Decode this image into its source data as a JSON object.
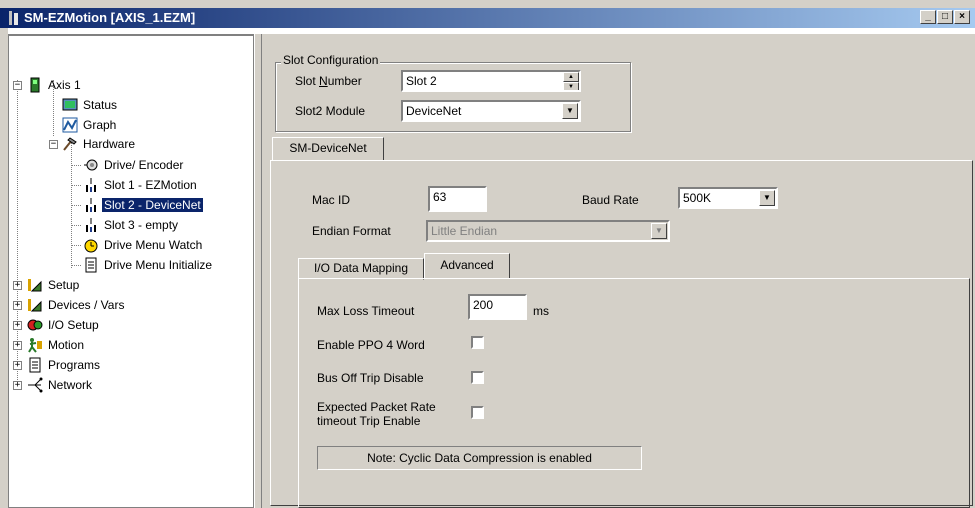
{
  "window": {
    "title": "SM-EZMotion   [AXIS_1.EZM]",
    "min_glyph": "_",
    "max_glyph": "□",
    "close_glyph": "×"
  },
  "tree": {
    "root": {
      "label": "Axis 1",
      "expander": "−"
    },
    "items": [
      {
        "label": "Status",
        "icon": "status-icon"
      },
      {
        "label": "Graph",
        "icon": "graph-icon"
      },
      {
        "label": "Hardware",
        "icon": "hardware-icon",
        "expander": "−"
      },
      {
        "label": "Drive/ Encoder",
        "icon": "encoder-icon"
      },
      {
        "label": "Slot 1 - EZMotion",
        "icon": "slot-icon"
      },
      {
        "label": "Slot 2 - DeviceNet",
        "icon": "slot-icon",
        "selected": true
      },
      {
        "label": "Slot 3 - empty",
        "icon": "slot-icon"
      },
      {
        "label": "Drive Menu Watch",
        "icon": "watch-icon"
      },
      {
        "label": "Drive Menu Initialize",
        "icon": "initialize-icon"
      },
      {
        "label": "Setup",
        "icon": "setup-icon",
        "expander": "+"
      },
      {
        "label": "Devices / Vars",
        "icon": "devices-icon",
        "expander": "+"
      },
      {
        "label": "I/O Setup",
        "icon": "io-icon",
        "expander": "+"
      },
      {
        "label": "Motion",
        "icon": "motion-icon",
        "expander": "+"
      },
      {
        "label": "Programs",
        "icon": "programs-icon",
        "expander": "+"
      },
      {
        "label": "Network",
        "icon": "network-icon",
        "expander": "+"
      }
    ]
  },
  "slot_config": {
    "group_label": "Slot Configuration",
    "slot_number_label_pre": "Slot ",
    "slot_number_label_u": "N",
    "slot_number_label_post": "umber",
    "slot_number_value": "Slot 2",
    "module_label": "Slot2 Module",
    "module_value": "DeviceNet"
  },
  "main_tab": {
    "label": "SM-DeviceNet"
  },
  "devicenet": {
    "mac_id_label": "Mac ID",
    "mac_id_value": "63",
    "baud_rate_label": "Baud Rate",
    "baud_rate_value": "500K",
    "endian_label": "Endian Format",
    "endian_value": "Little Endian"
  },
  "sub_tabs": [
    {
      "label": "I/O Data Mapping",
      "active": false
    },
    {
      "label": "Advanced",
      "active": true
    }
  ],
  "advanced": {
    "max_loss_label": "Max Loss Timeout",
    "max_loss_value": "200",
    "max_loss_unit": "ms",
    "ppo4_label": "Enable PPO 4 Word",
    "ppo4_checked": false,
    "bus_off_label": "Bus Off Trip Disable",
    "bus_off_checked": false,
    "expected_line1": "Expected Packet Rate",
    "expected_line2": "timeout Trip Enable",
    "expected_checked": false,
    "note": "Note: Cyclic Data Compression is enabled"
  },
  "colors": {
    "titlebar_start": "#0a246a",
    "titlebar_end": "#a6caf0",
    "selection": "#0a246a",
    "face": "#d4d0c8"
  }
}
